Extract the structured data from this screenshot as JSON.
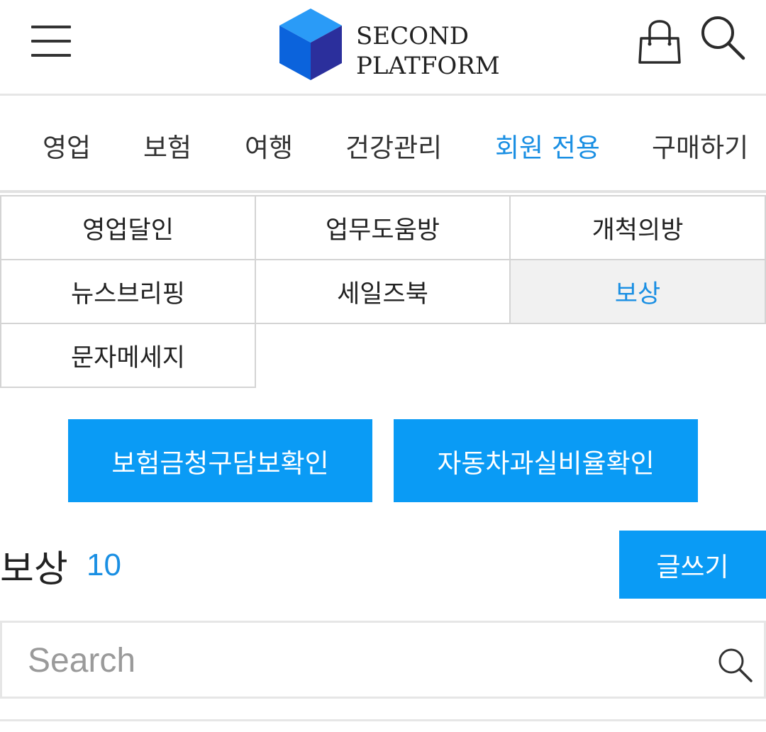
{
  "brand": {
    "line1": "SECOND",
    "line2": "PLATFORM",
    "logo_icon": "cube-icon",
    "cube_colors": [
      "#1c8ff0",
      "#0d5fd6",
      "#2a2f9e"
    ]
  },
  "header": {
    "menu_icon": "hamburger-menu-icon",
    "cart_icon": "shopping-bag-icon",
    "search_icon": "search-icon"
  },
  "nav": {
    "items": [
      {
        "label": "영업",
        "active": false
      },
      {
        "label": "보험",
        "active": false
      },
      {
        "label": "여행",
        "active": false
      },
      {
        "label": "건강관리",
        "active": false
      },
      {
        "label": "회원 전용",
        "active": true
      },
      {
        "label": "구매하기",
        "active": false
      }
    ]
  },
  "submenu": {
    "items": [
      {
        "label": "영업달인",
        "active": false
      },
      {
        "label": "업무도움방",
        "active": false
      },
      {
        "label": "개척의방",
        "active": false
      },
      {
        "label": "뉴스브리핑",
        "active": false
      },
      {
        "label": "세일즈북",
        "active": false
      },
      {
        "label": "보상",
        "active": true
      },
      {
        "label": "문자메세지",
        "active": false
      }
    ]
  },
  "actions": {
    "claim_button": "보험금청구담보확인",
    "fault_button": "자동차과실비율확인"
  },
  "board": {
    "title": "보상",
    "count": "10",
    "write_button": "글쓰기"
  },
  "search": {
    "placeholder": "Search",
    "value": ""
  },
  "colors": {
    "accent": "#1a8fe3",
    "button": "#0a9bf5",
    "active_cell_bg": "#f1f1f1"
  }
}
